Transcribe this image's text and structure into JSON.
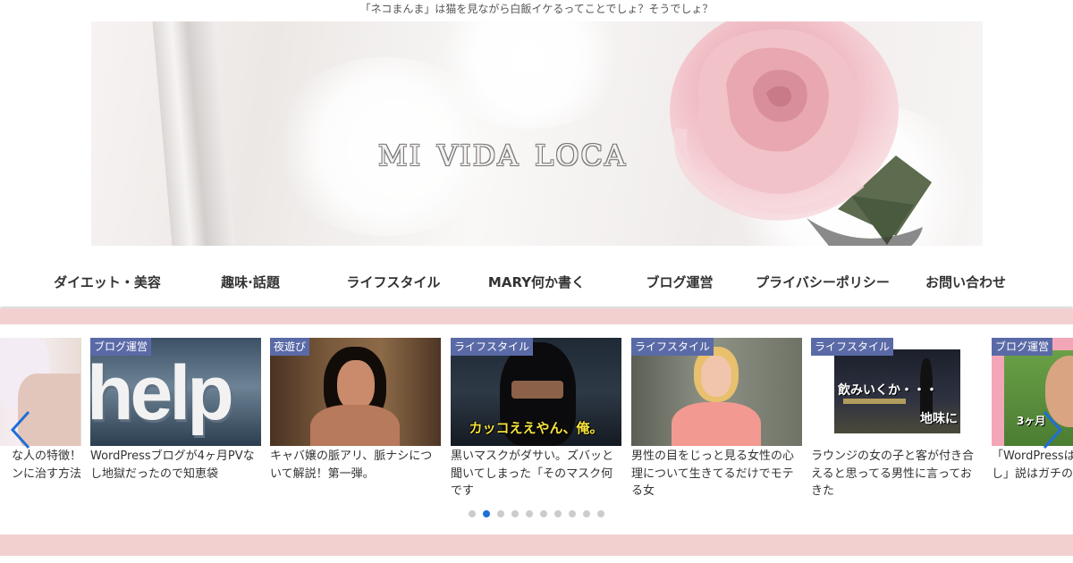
{
  "site": {
    "tagline": "「ネコまんま」は猫を見ながら白飯イケるってことでしょ？そうでしょ？",
    "logo_text": "mi vida loca"
  },
  "nav": {
    "items": [
      {
        "label": "ダイエット・美容"
      },
      {
        "label": "趣味·話題"
      },
      {
        "label": "ライフスタイル"
      },
      {
        "label": "MARY何か書く"
      },
      {
        "label": "ブログ運営"
      },
      {
        "label": "プライバシーポリシー"
      },
      {
        "label": "お問い合わせ"
      }
    ]
  },
  "carousel": {
    "cards": [
      {
        "category": "",
        "title": "な人の特徴！\nンに治す方法"
      },
      {
        "category": "ブログ運営",
        "title": "WordPressブログが4ヶ月PVなし地獄だったので知恵袋",
        "thumb_text": "help"
      },
      {
        "category": "夜遊び",
        "title": "キャバ嬢の脈アリ、脈ナシについて解説！第一弾。"
      },
      {
        "category": "ライフスタイル",
        "title": "黒いマスクがダサい。ズバッと聞いてしまった「そのマスク何です",
        "thumb_text": "カッコええやん、俺。"
      },
      {
        "category": "ライフスタイル",
        "title": "男性の目をじっと見る女性の心理について生きてるだけでモテる女"
      },
      {
        "category": "ライフスタイル",
        "title": "ラウンジの女の子と客が付き合えると思ってる男性に言っておきた",
        "thumb_text": "飲みいくか・・・",
        "thumb_text2": "地味に"
      },
      {
        "category": "ブログ運営",
        "title": "「WordPressは\nし」説はガチの",
        "thumb_text": "3ヶ月"
      }
    ],
    "dots_count": 10,
    "active_dot": 1
  },
  "colors": {
    "band_pink": "#f3d0d0",
    "category_bg": "#5a6aa7",
    "dot_active": "#1e6fd9",
    "dot_inactive": "#cccccc",
    "arrow": "#1e6fd9"
  }
}
